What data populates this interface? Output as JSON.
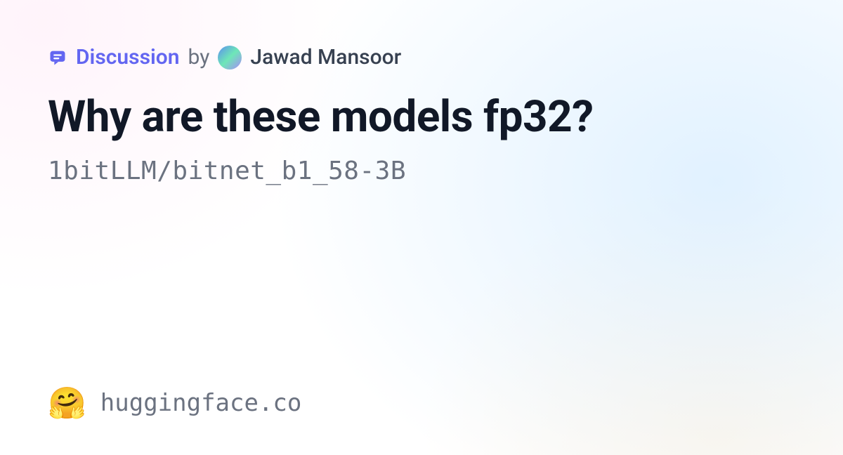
{
  "meta": {
    "discussion_label": "Discussion",
    "by": "by",
    "author": "Jawad Mansoor"
  },
  "title": "Why are these models fp32?",
  "repo": "1bitLLM/bitnet_b1_58-3B",
  "footer": {
    "emoji": "🤗",
    "site": "huggingface.co"
  }
}
